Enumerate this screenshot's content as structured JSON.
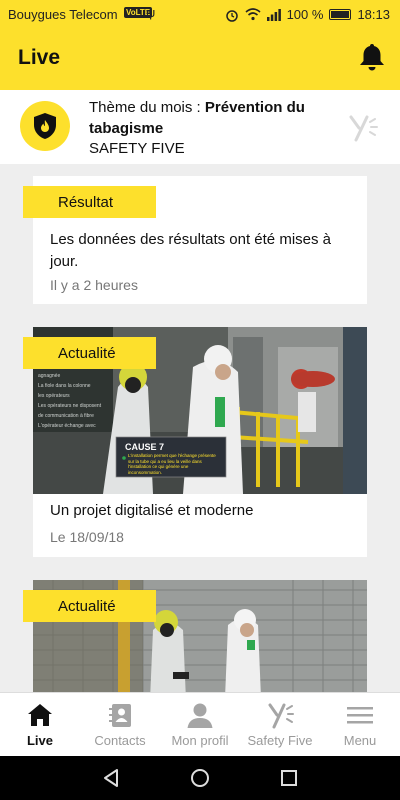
{
  "status_bar": {
    "carrier": "Bouygues Telecom",
    "volte": "VoLTE",
    "battery": "100 %",
    "time": "18:13"
  },
  "header": {
    "title": "Live"
  },
  "theme": {
    "prefix": "Thème du mois : ",
    "topic": "Prévention du tabagisme",
    "brand": "SAFETY FIVE"
  },
  "feed": [
    {
      "tag": "Résultat",
      "title": "Les données des résultats ont été mises à jour.",
      "meta": "Il y a 2 heures"
    },
    {
      "tag": "Actualité",
      "title": "Un projet digitalisé et moderne",
      "meta": "Le 18/09/18",
      "caption_title": "CAUSE 7",
      "caption_text": "L'installation permet que l'échange présente sur la tube qui a eu lieu la veille dans l'installation ce qui génère une inconsommation."
    },
    {
      "tag": "Actualité"
    }
  ],
  "nav": [
    {
      "label": "Live",
      "icon": "home-icon",
      "active": true
    },
    {
      "label": "Contacts",
      "icon": "contacts-icon"
    },
    {
      "label": "Mon profil",
      "icon": "profile-icon"
    },
    {
      "label": "Safety Five",
      "icon": "safety-five-logo-icon"
    },
    {
      "label": "Menu",
      "icon": "menu-icon"
    }
  ],
  "colors": {
    "accent": "#fde02c",
    "background": "#eeeeee",
    "text": "#111111",
    "muted": "#777777"
  }
}
